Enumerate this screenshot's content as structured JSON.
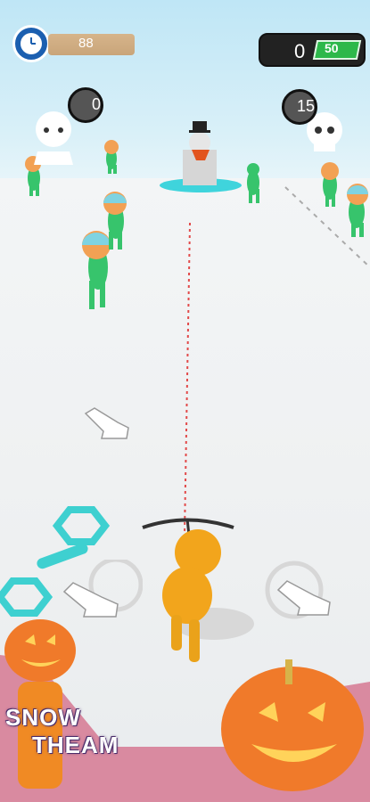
{
  "hud": {
    "timer_value": "88",
    "score_value": "0",
    "money_value": "50",
    "left_ring_value": "0",
    "right_ring_value": "15"
  },
  "icons": {
    "timer": "clock-icon",
    "money": "money-icon",
    "target": "skull-icon",
    "target_left": "ghost-face-icon",
    "tap_hint": "pointing-hand-icon"
  },
  "overlay": {
    "line1": "SNOW",
    "line2": "THEAM"
  },
  "colors": {
    "sky": "#cfeef8",
    "enemy": "#37c46c",
    "player": "#f2a51c",
    "teal": "#3ed0d0",
    "money_green": "#2db84a",
    "pink": "#d98aa0"
  }
}
